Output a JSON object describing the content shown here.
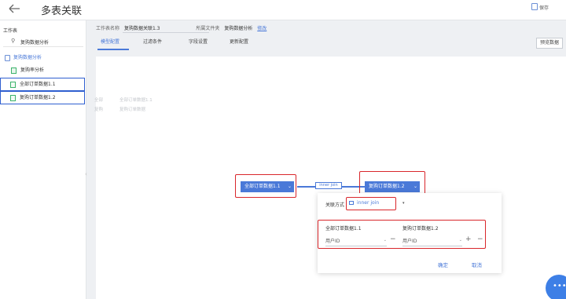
{
  "header": {
    "title": "多表关联",
    "save_label": "保存"
  },
  "sidebar": {
    "title": "工作表",
    "search_value": "复购数据分析",
    "tree": [
      {
        "label": "复购数据分析",
        "kind": "folder"
      },
      {
        "label": "复购率分析",
        "kind": "file"
      },
      {
        "label": "全部订单数据1.1",
        "kind": "table",
        "selected": true
      },
      {
        "label": "复购订单数据1.2",
        "kind": "table",
        "selected": true
      }
    ]
  },
  "meta": {
    "name_label": "工作表名称",
    "name_value": "复购数据关联1.3",
    "folder_label": "所属文件夹",
    "folder_value": "复购数据分析",
    "edit_link": "修改"
  },
  "tabs": [
    "模型配置",
    "过滤条件",
    "字段设置",
    "更新配置"
  ],
  "active_tab": 0,
  "preview_label": "预览数据",
  "ghost_text": {
    "row1_left": "全部",
    "row1_right": "全部订单数据1.1",
    "row2_left": "复购",
    "row2_right": "复购订单数据"
  },
  "nodes": {
    "left": "全部订单数据1.1",
    "right": "复购订单数据1.2",
    "caret": "⌄"
  },
  "join_badge": "inner join",
  "popup": {
    "join_label": "关联方式",
    "join_value": "inner join",
    "left_table": "全部订单数据1.1",
    "right_table": "复购订单数据1.2",
    "left_field": "用户ID",
    "right_field": "用户ID",
    "minus": "−",
    "plus": "+",
    "confirm_label": "确定",
    "cancel_label": "取消"
  },
  "colors": {
    "accent": "#4a79d8",
    "highlight": "#d9262b"
  }
}
